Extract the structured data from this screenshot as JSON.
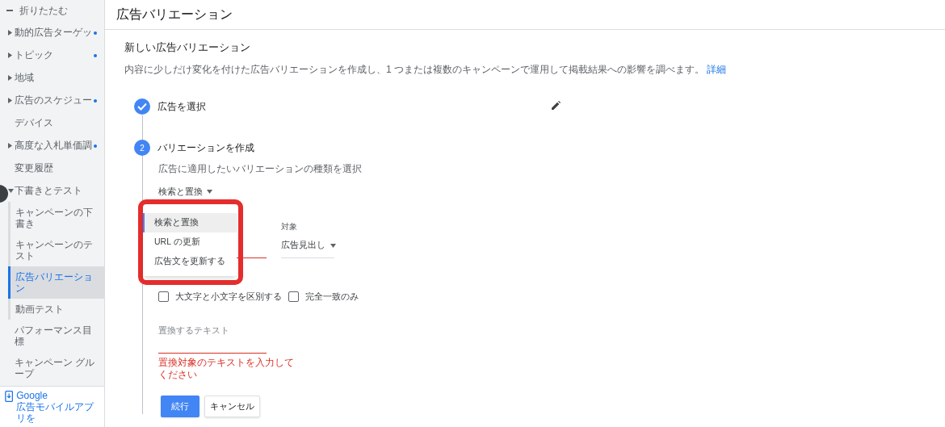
{
  "sidebar": {
    "collapse_label": "折りたたむ",
    "items": [
      {
        "label": "動的広告ターゲッ",
        "kind": "group",
        "expanded": false,
        "has_dot": true,
        "selected": false
      },
      {
        "label": "トピック",
        "kind": "group",
        "expanded": false,
        "has_dot": true,
        "selected": false
      },
      {
        "label": "地域",
        "kind": "group",
        "expanded": false,
        "has_dot": false,
        "selected": false
      },
      {
        "label": "広告のスケジュー",
        "kind": "group",
        "expanded": false,
        "has_dot": true,
        "selected": false
      },
      {
        "label": "デバイス",
        "kind": "link",
        "has_dot": false,
        "selected": false
      },
      {
        "label": "高度な入札単価調",
        "kind": "group",
        "expanded": false,
        "has_dot": true,
        "selected": false
      },
      {
        "label": "変更履歴",
        "kind": "link",
        "has_dot": false,
        "selected": false
      },
      {
        "label": "下書きとテスト",
        "kind": "group",
        "expanded": true,
        "has_dot": false,
        "selected": false,
        "children": [
          {
            "label": "キャンペーンの下書き",
            "selected": false
          },
          {
            "label": "キャンペーンのテスト",
            "selected": false
          },
          {
            "label": "広告バリエーション",
            "selected": true
          },
          {
            "label": "動画テスト",
            "selected": false
          }
        ]
      },
      {
        "label": "パフォーマンス目標",
        "kind": "link",
        "has_dot": false,
        "selected": false
      },
      {
        "label": "キャンペーン グループ",
        "kind": "link",
        "has_dot": false,
        "selected": false
      }
    ],
    "promo": {
      "title": "Google",
      "text": "広告モバイルアプリを"
    }
  },
  "page_title": "広告バリエーション",
  "section_title": "新しい広告バリエーション",
  "description": "内容に少しだけ変化を付けた広告バリエーションを作成し、1 つまたは複数のキャンペーンで運用して掲載結果への影響を調べます。",
  "learn_more": "詳細",
  "steps": [
    {
      "label": "広告を選択",
      "done": true
    },
    {
      "label": "バリエーションを作成",
      "done": false,
      "number": "2"
    }
  ],
  "form": {
    "type_hint": "広告に適用したいバリエーションの種類を選択",
    "type_value": "検索と置換",
    "type_menu": [
      {
        "label": "検索と置換",
        "selected": true
      },
      {
        "label": "URL の更新",
        "selected": false
      },
      {
        "label": "広告文を更新する",
        "selected": false
      }
    ],
    "target_label": "対象",
    "target_value": "広告見出し",
    "checkboxes": [
      {
        "label": "大文字と小文字を区別する",
        "checked": false
      },
      {
        "label": "完全一致のみ",
        "checked": false
      }
    ],
    "replace_placeholder": "置換するテキスト",
    "replace_error": "置換対象のテキストを入力してください",
    "buttons": {
      "primary": "続行",
      "secondary": "キャンセル"
    }
  }
}
